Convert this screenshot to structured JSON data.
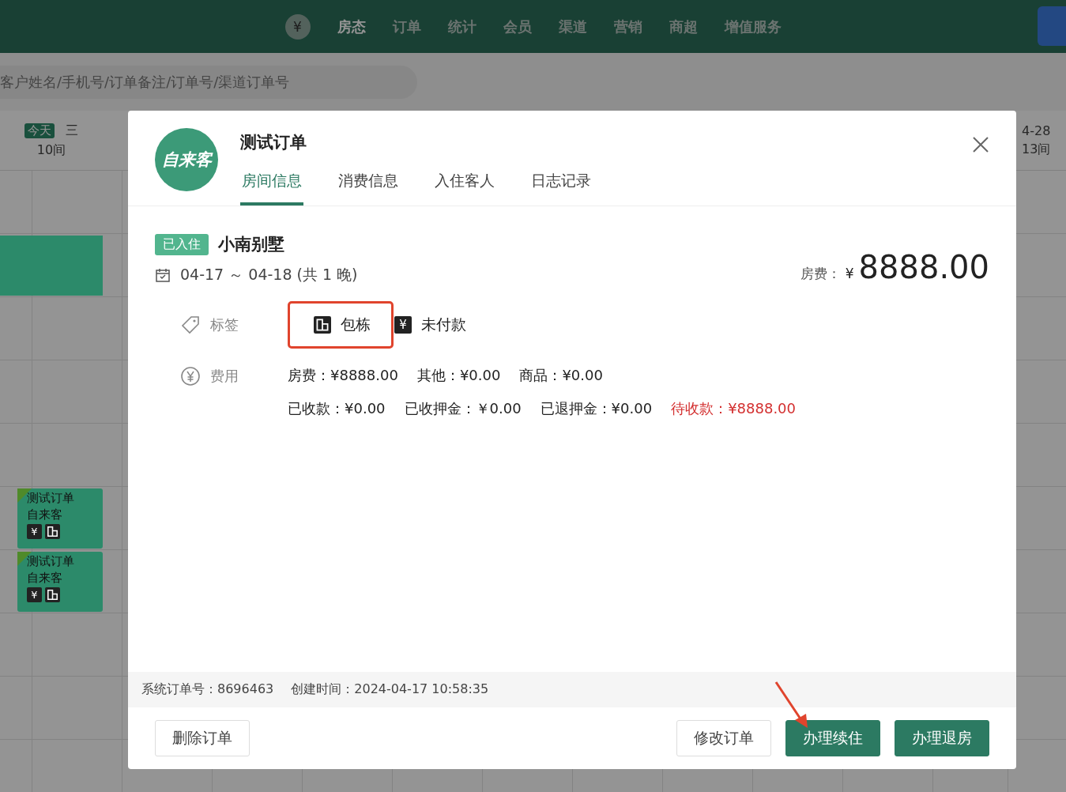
{
  "nav": {
    "coin": "¥",
    "items": [
      {
        "label": "房态",
        "selected": true
      },
      {
        "label": "订单",
        "selected": false
      },
      {
        "label": "统计",
        "selected": false
      },
      {
        "label": "会员",
        "selected": false
      },
      {
        "label": "渠道",
        "selected": false
      },
      {
        "label": "营销",
        "selected": false
      },
      {
        "label": "商超",
        "selected": false
      },
      {
        "label": "增值服务",
        "selected": false
      }
    ]
  },
  "search": {
    "placeholder": "客户姓名/手机号/订单备注/订单号/渠道订单号"
  },
  "calendar": {
    "today_badge": "今天",
    "weekday": "三",
    "count": "10间",
    "last_date": "4-28",
    "last_count": "13间"
  },
  "bookings": [
    {
      "kind": "block"
    },
    {
      "kind": "order",
      "title": "测试订单",
      "source": "自来客",
      "pay_icon": "¥"
    },
    {
      "kind": "order",
      "title": "测试订单",
      "source": "自来客",
      "pay_icon": "¥"
    }
  ],
  "modal": {
    "avatar": "自来客",
    "title": "测试订单",
    "tabs": [
      {
        "label": "房间信息",
        "selected": true
      },
      {
        "label": "消费信息",
        "selected": false
      },
      {
        "label": "入住客人",
        "selected": false
      },
      {
        "label": "日志记录",
        "selected": false
      }
    ],
    "status": "已入住",
    "room": "小南别墅",
    "dates": "04-17 ～ 04-18 (共 1 晚)",
    "price_label": "房费：",
    "currency": "¥",
    "price": "8888.00",
    "tags_label": "标签",
    "tags": [
      {
        "kind": "whole-house",
        "label": "包栋",
        "annotated": true
      },
      {
        "kind": "unpaid",
        "icon_text": "¥",
        "label": "未付款",
        "annotated": false
      }
    ],
    "fees_label": "费用",
    "fee_rows": [
      [
        {
          "text": "房费：¥8888.00",
          "kind": "normal"
        },
        {
          "text": "其他：¥0.00",
          "kind": "normal"
        },
        {
          "text": "商品：¥0.00",
          "kind": "normal"
        }
      ],
      [
        {
          "text": "已收款：¥0.00",
          "kind": "normal"
        },
        {
          "text": "已收押金：￥0.00",
          "kind": "normal"
        },
        {
          "text": "已退押金：¥0.00",
          "kind": "normal"
        },
        {
          "text": "待收款：¥8888.00",
          "kind": "due"
        }
      ]
    ],
    "info": [
      "系统订单号：8696463",
      "创建时间：2024-04-17 10:58:35"
    ],
    "buttons": [
      {
        "label": "删除订单",
        "kind": "default",
        "arrow": false
      },
      {
        "label": "修改订单",
        "kind": "default",
        "arrow": false
      },
      {
        "label": "办理续住",
        "kind": "primary",
        "arrow": true
      },
      {
        "label": "办理退房",
        "kind": "primary",
        "arrow": false
      }
    ]
  }
}
